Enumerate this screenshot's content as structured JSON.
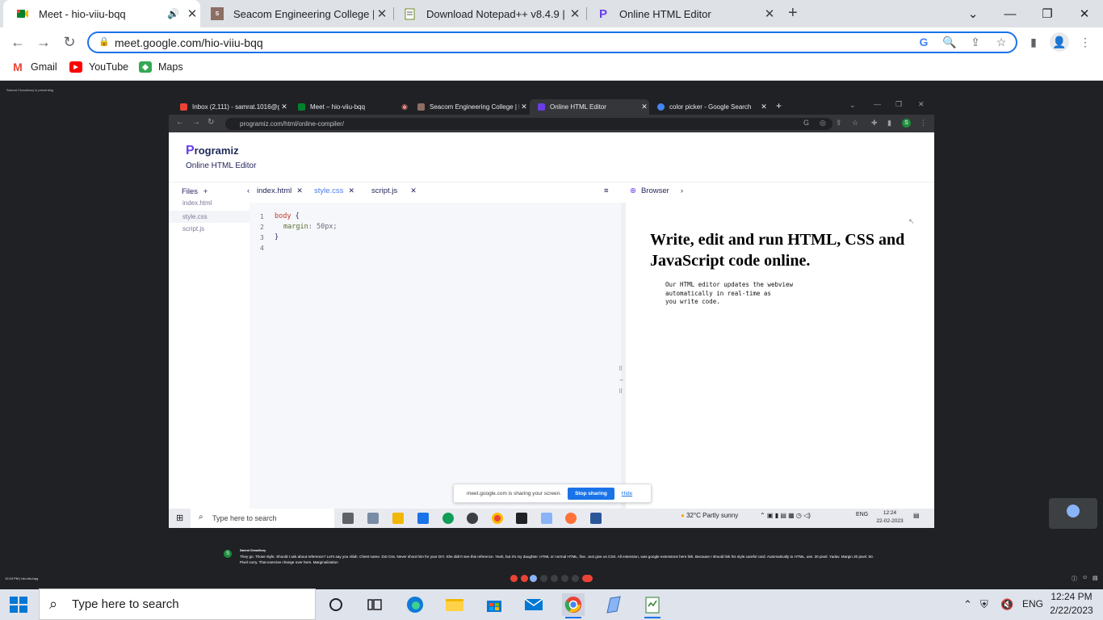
{
  "chrome": {
    "tabs": [
      {
        "title": "Meet - hio-viiu-bqq",
        "active": true
      },
      {
        "title": "Seacom Engineering College | Be"
      },
      {
        "title": "Download Notepad++ v8.4.9 | N"
      },
      {
        "title": "Online HTML Editor"
      }
    ],
    "new_tab": "+",
    "url": "meet.google.com/hio-viiu-bqq",
    "bookmarks": [
      "Gmail",
      "YouTube",
      "Maps"
    ]
  },
  "meet": {
    "presenting_label": "Samrat Chowdhury is presenting",
    "shared": {
      "tabs": [
        {
          "title": "Inbox (2,111) - samrat.1016@gm"
        },
        {
          "title": "Meet – hio-viiu-bqq"
        },
        {
          "title": "Seacom Engineering College | Be"
        },
        {
          "title": "Online HTML Editor",
          "active": true
        },
        {
          "title": "color picker - Google Search"
        }
      ],
      "url": "programiz.com/html/online-compiler/",
      "programiz": {
        "logo": "Programiz",
        "subtitle": "Online HTML Editor",
        "files_header": "Files",
        "files": [
          "index.html",
          "style.css",
          "script.js"
        ],
        "editor_tabs": [
          "index.html",
          "style.css",
          "script.js"
        ],
        "line_numbers": [
          "1",
          "2",
          "3",
          "4"
        ],
        "code": {
          "l1_selector": "body",
          "l1_brace": " {",
          "l2_prop": "margin",
          "l2_value": ": 50px;",
          "l3": "}"
        },
        "browser_label": "Browser",
        "preview_heading": "Write, edit and run HTML, CSS and JavaScript code online.",
        "preview_text": "Our HTML editor updates the webview\nautomatically in real-time as\nyou write code."
      },
      "share_bar": {
        "text": "meet.google.com is sharing your screen.",
        "stop": "Stop sharing",
        "hide": "Hide"
      },
      "taskbar": {
        "search": "Type here to search",
        "weather": "32°C  Partly sunny",
        "lang": "ENG",
        "time": "12:24",
        "date": "22-02-2023"
      }
    },
    "caption": {
      "speaker": "Samrat Chowdhury",
      "text": "They go. Those style. Should I ask about reference? Let's say you Allah. Chest name. Dot Css. Never shoot him for your DIY. She didn't see this reference. Yeah, but it's my daughter. HTML or normal HTML, fine. Just give us CSS. All extension, was google extensions here link. Because I should link his style.careful card. Automatically to HTML, use. 20 pixel. Yadav. Margin 20 pixel. 50. Pixel curry. That exercise change over here. Marginalization"
    },
    "meeting_info": "12:24 PM  |  hio-viiu-bqq"
  },
  "taskbar": {
    "search_placeholder": "Type here to search",
    "lang": "ENG",
    "time": "12:24 PM",
    "date": "2/22/2023"
  }
}
